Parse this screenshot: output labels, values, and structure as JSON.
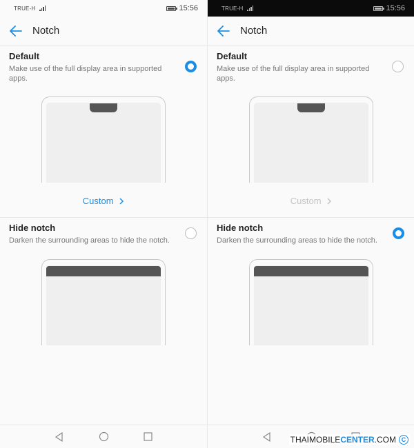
{
  "left": {
    "status": {
      "carrier": "TRUE-H",
      "time": "15:56"
    },
    "header": {
      "title": "Notch"
    },
    "default_option": {
      "title": "Default",
      "desc": "Make use of the full display area in supported apps.",
      "selected": true
    },
    "custom_label": "Custom",
    "hide_option": {
      "title": "Hide notch",
      "desc": "Darken the surrounding areas to hide the notch.",
      "selected": false
    }
  },
  "right": {
    "status": {
      "carrier": "TRUE-H",
      "time": "15:56"
    },
    "header": {
      "title": "Notch"
    },
    "default_option": {
      "title": "Default",
      "desc": "Make use of the full display area in supported apps.",
      "selected": false
    },
    "custom_label": "Custom",
    "hide_option": {
      "title": "Hide notch",
      "desc": "Darken the surrounding areas to hide the notch.",
      "selected": true
    }
  },
  "icons": {
    "back": "arrow-left-icon",
    "nav_back": "triangle-back-icon",
    "nav_home": "circle-home-icon",
    "nav_recent": "square-recent-icon"
  },
  "watermark": {
    "part1": "THAIMOBILE",
    "part2": "CENTER",
    "part3": ".COM",
    "symbol": "C"
  },
  "colors": {
    "accent": "#1a8ee6",
    "disabled": "#c4c4c4",
    "notch": "#555555"
  }
}
